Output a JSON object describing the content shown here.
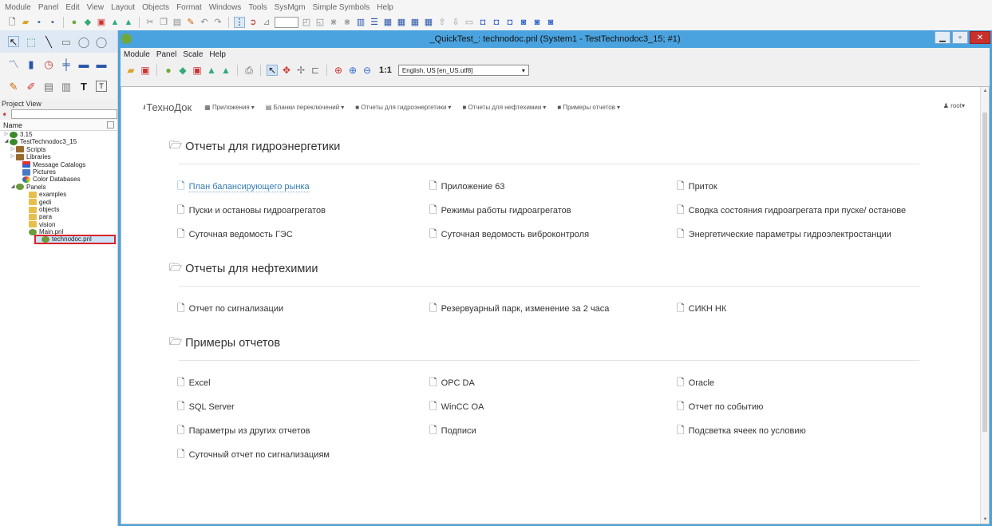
{
  "outer_menu": [
    "Module",
    "Panel",
    "Edit",
    "View",
    "Layout",
    "Objects",
    "Format",
    "Windows",
    "Tools",
    "SysMgm",
    "Simple Symbols",
    "Help"
  ],
  "project_view": {
    "title": "Project View",
    "column_name": "Name",
    "tree": [
      {
        "label": "3.15",
        "type": "proj",
        "indent": 0,
        "expander": "▷"
      },
      {
        "label": "TestTechnodoc3_15",
        "type": "proj",
        "indent": 0,
        "expander": "◢"
      },
      {
        "label": "Scripts",
        "type": "script",
        "indent": 1,
        "expander": "▷"
      },
      {
        "label": "Libraries",
        "type": "script",
        "indent": 1,
        "expander": "▷"
      },
      {
        "label": "Message Catalogs",
        "type": "msg",
        "indent": 2,
        "expander": ""
      },
      {
        "label": "Pictures",
        "type": "pic",
        "indent": 2,
        "expander": ""
      },
      {
        "label": "Color Databases",
        "type": "color",
        "indent": 2,
        "expander": ""
      },
      {
        "label": "Panels",
        "type": "panel",
        "indent": 1,
        "expander": "◢"
      },
      {
        "label": "examples",
        "type": "folder",
        "indent": 3,
        "expander": ""
      },
      {
        "label": "gedi",
        "type": "folder",
        "indent": 3,
        "expander": ""
      },
      {
        "label": "objects",
        "type": "folder",
        "indent": 3,
        "expander": ""
      },
      {
        "label": "para",
        "type": "folder",
        "indent": 3,
        "expander": ""
      },
      {
        "label": "vision",
        "type": "folder",
        "indent": 3,
        "expander": ""
      },
      {
        "label": "Main.pnl",
        "type": "panel",
        "indent": 3,
        "expander": ""
      },
      {
        "label": "technodoc.pnl",
        "type": "panel",
        "indent": 3,
        "expander": "",
        "selected": true
      }
    ]
  },
  "window": {
    "title": "_QuickTest_: technodoc.pnl (System1 - TestTechnodoc3_15; #1)",
    "menu": [
      "Module",
      "Panel",
      "Scale",
      "Help"
    ],
    "scale_label": "1:1",
    "locale": "English, US [en_US.utf8]"
  },
  "navbar": {
    "brand": "ТехноДок",
    "items": [
      "Приложения",
      "Бланки переключений",
      "Отчеты для гидроэнергетики",
      "Отчеты для нефтехимии",
      "Примеры отчетов"
    ],
    "user": "root"
  },
  "sections": [
    {
      "title": "Отчеты для гидроэнергетики",
      "rows": [
        [
          "План балансирующего рынка",
          "Приложение 63",
          "Приток"
        ],
        [
          "Пуски и остановы гидроагрегатов",
          "Режимы работы гидроагрегатов",
          "Сводка состояния гидроагрегата при пуске/ останове"
        ],
        [
          "Суточная ведомость ГЭС",
          "Суточная ведомость виброконтроля",
          "Энергетические параметры гидроэлектростанции"
        ]
      ]
    },
    {
      "title": "Отчеты для нефтехимии",
      "rows": [
        [
          "Отчет по сигнализации",
          "Резервуарный парк, изменение за 2 часа",
          "СИКН НК"
        ]
      ]
    },
    {
      "title": "Примеры отчетов",
      "rows": [
        [
          "Excel",
          "OPC DA",
          "Oracle"
        ],
        [
          "SQL Server",
          "WinCC OA",
          "Отчет по событию"
        ],
        [
          "Параметры из других отчетов",
          "Подписи",
          "Подсветка ячеек по условию"
        ],
        [
          "Суточный отчет по сигнализациям"
        ]
      ]
    }
  ]
}
